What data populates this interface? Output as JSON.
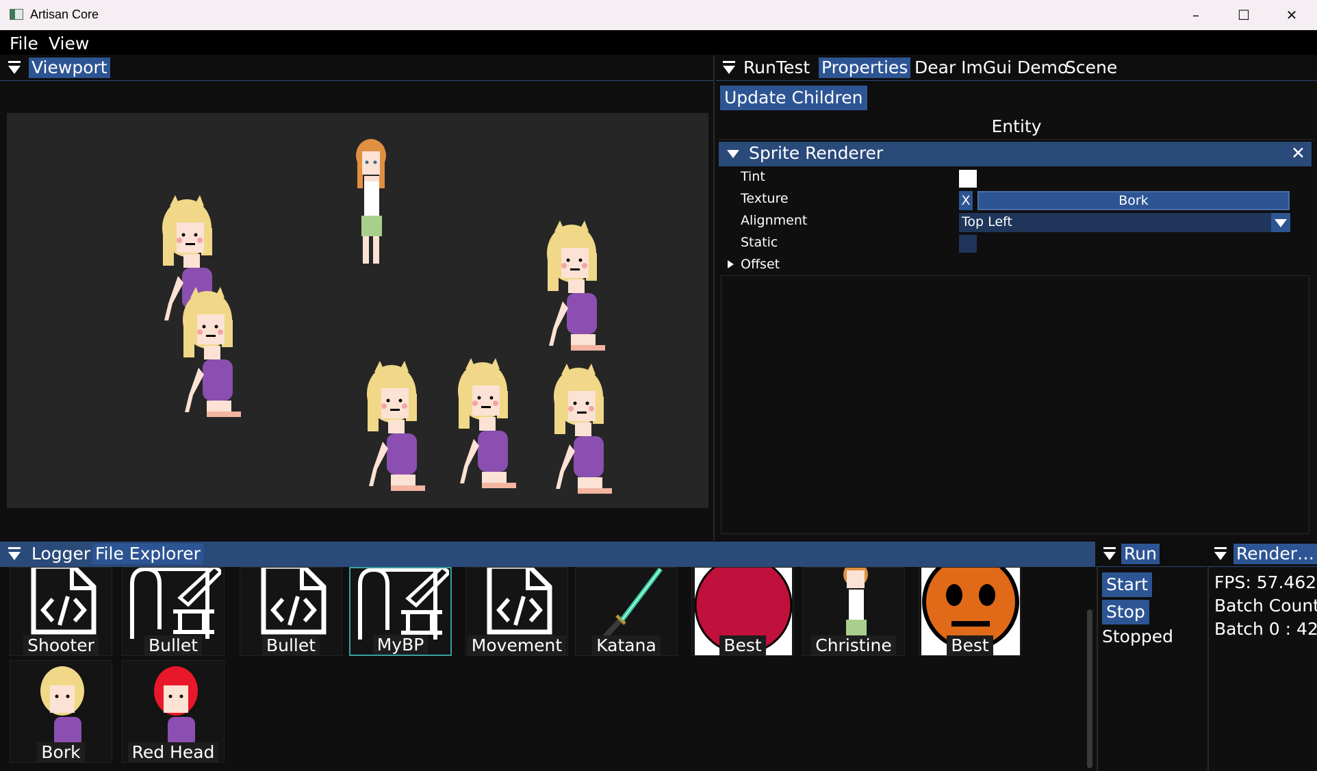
{
  "window": {
    "title": "Artisan Core",
    "controls": [
      "–",
      "☐",
      "✕"
    ]
  },
  "menu": {
    "items": [
      "File",
      "View"
    ]
  },
  "viewport_panel": {
    "tabs": [
      "Viewport"
    ]
  },
  "right_panel": {
    "tabs": [
      "RunTest",
      "Properties",
      "Dear ImGui Demo",
      "Scene"
    ],
    "update_button": "Update Children",
    "entity_title": "Entity",
    "component": {
      "name": "Sprite Renderer",
      "close": "✕",
      "fields": {
        "tint_label": "Tint",
        "tint_color": "#ffffff",
        "texture_label": "Texture",
        "texture_clear": "X",
        "texture_value": "Bork",
        "alignment_label": "Alignment",
        "alignment_value": "Top Left",
        "static_label": "Static",
        "offset_label": "Offset"
      }
    }
  },
  "bottom_panel": {
    "tabs": [
      "Logger",
      "File Explorer"
    ],
    "files": [
      {
        "label": "Shooter",
        "icon": "code-file-icon"
      },
      {
        "label": "Bullet",
        "icon": "blueprint-icon"
      },
      {
        "label": "Bullet",
        "icon": "code-file-icon"
      },
      {
        "label": "MyBP",
        "icon": "blueprint-icon"
      },
      {
        "label": "Movement",
        "icon": "code-file-icon"
      },
      {
        "label": "Katana",
        "icon": "katana-sprite"
      },
      {
        "label": "Best",
        "icon": "red-circle-sprite"
      },
      {
        "label": "Christine",
        "icon": "girl-sprite"
      },
      {
        "label": "Best",
        "icon": "orange-face-sprite"
      },
      {
        "label": "Bork",
        "icon": "cat-girl-sprite"
      },
      {
        "label": "Red Head",
        "icon": "red-cat-girl-sprite"
      }
    ]
  },
  "run_panel": {
    "title": "Run",
    "start": "Start",
    "stop": "Stop",
    "status": "Stopped"
  },
  "render_panel": {
    "title": "Render…",
    "fps": "FPS: 57.462",
    "batch_count": "Batch Count",
    "batch0": "Batch 0 : 42"
  },
  "colors": {
    "accent": "#2d5594",
    "header": "#2a4a7a",
    "viewport_bg": "#262626",
    "panel_bg": "#0f0f0f"
  }
}
